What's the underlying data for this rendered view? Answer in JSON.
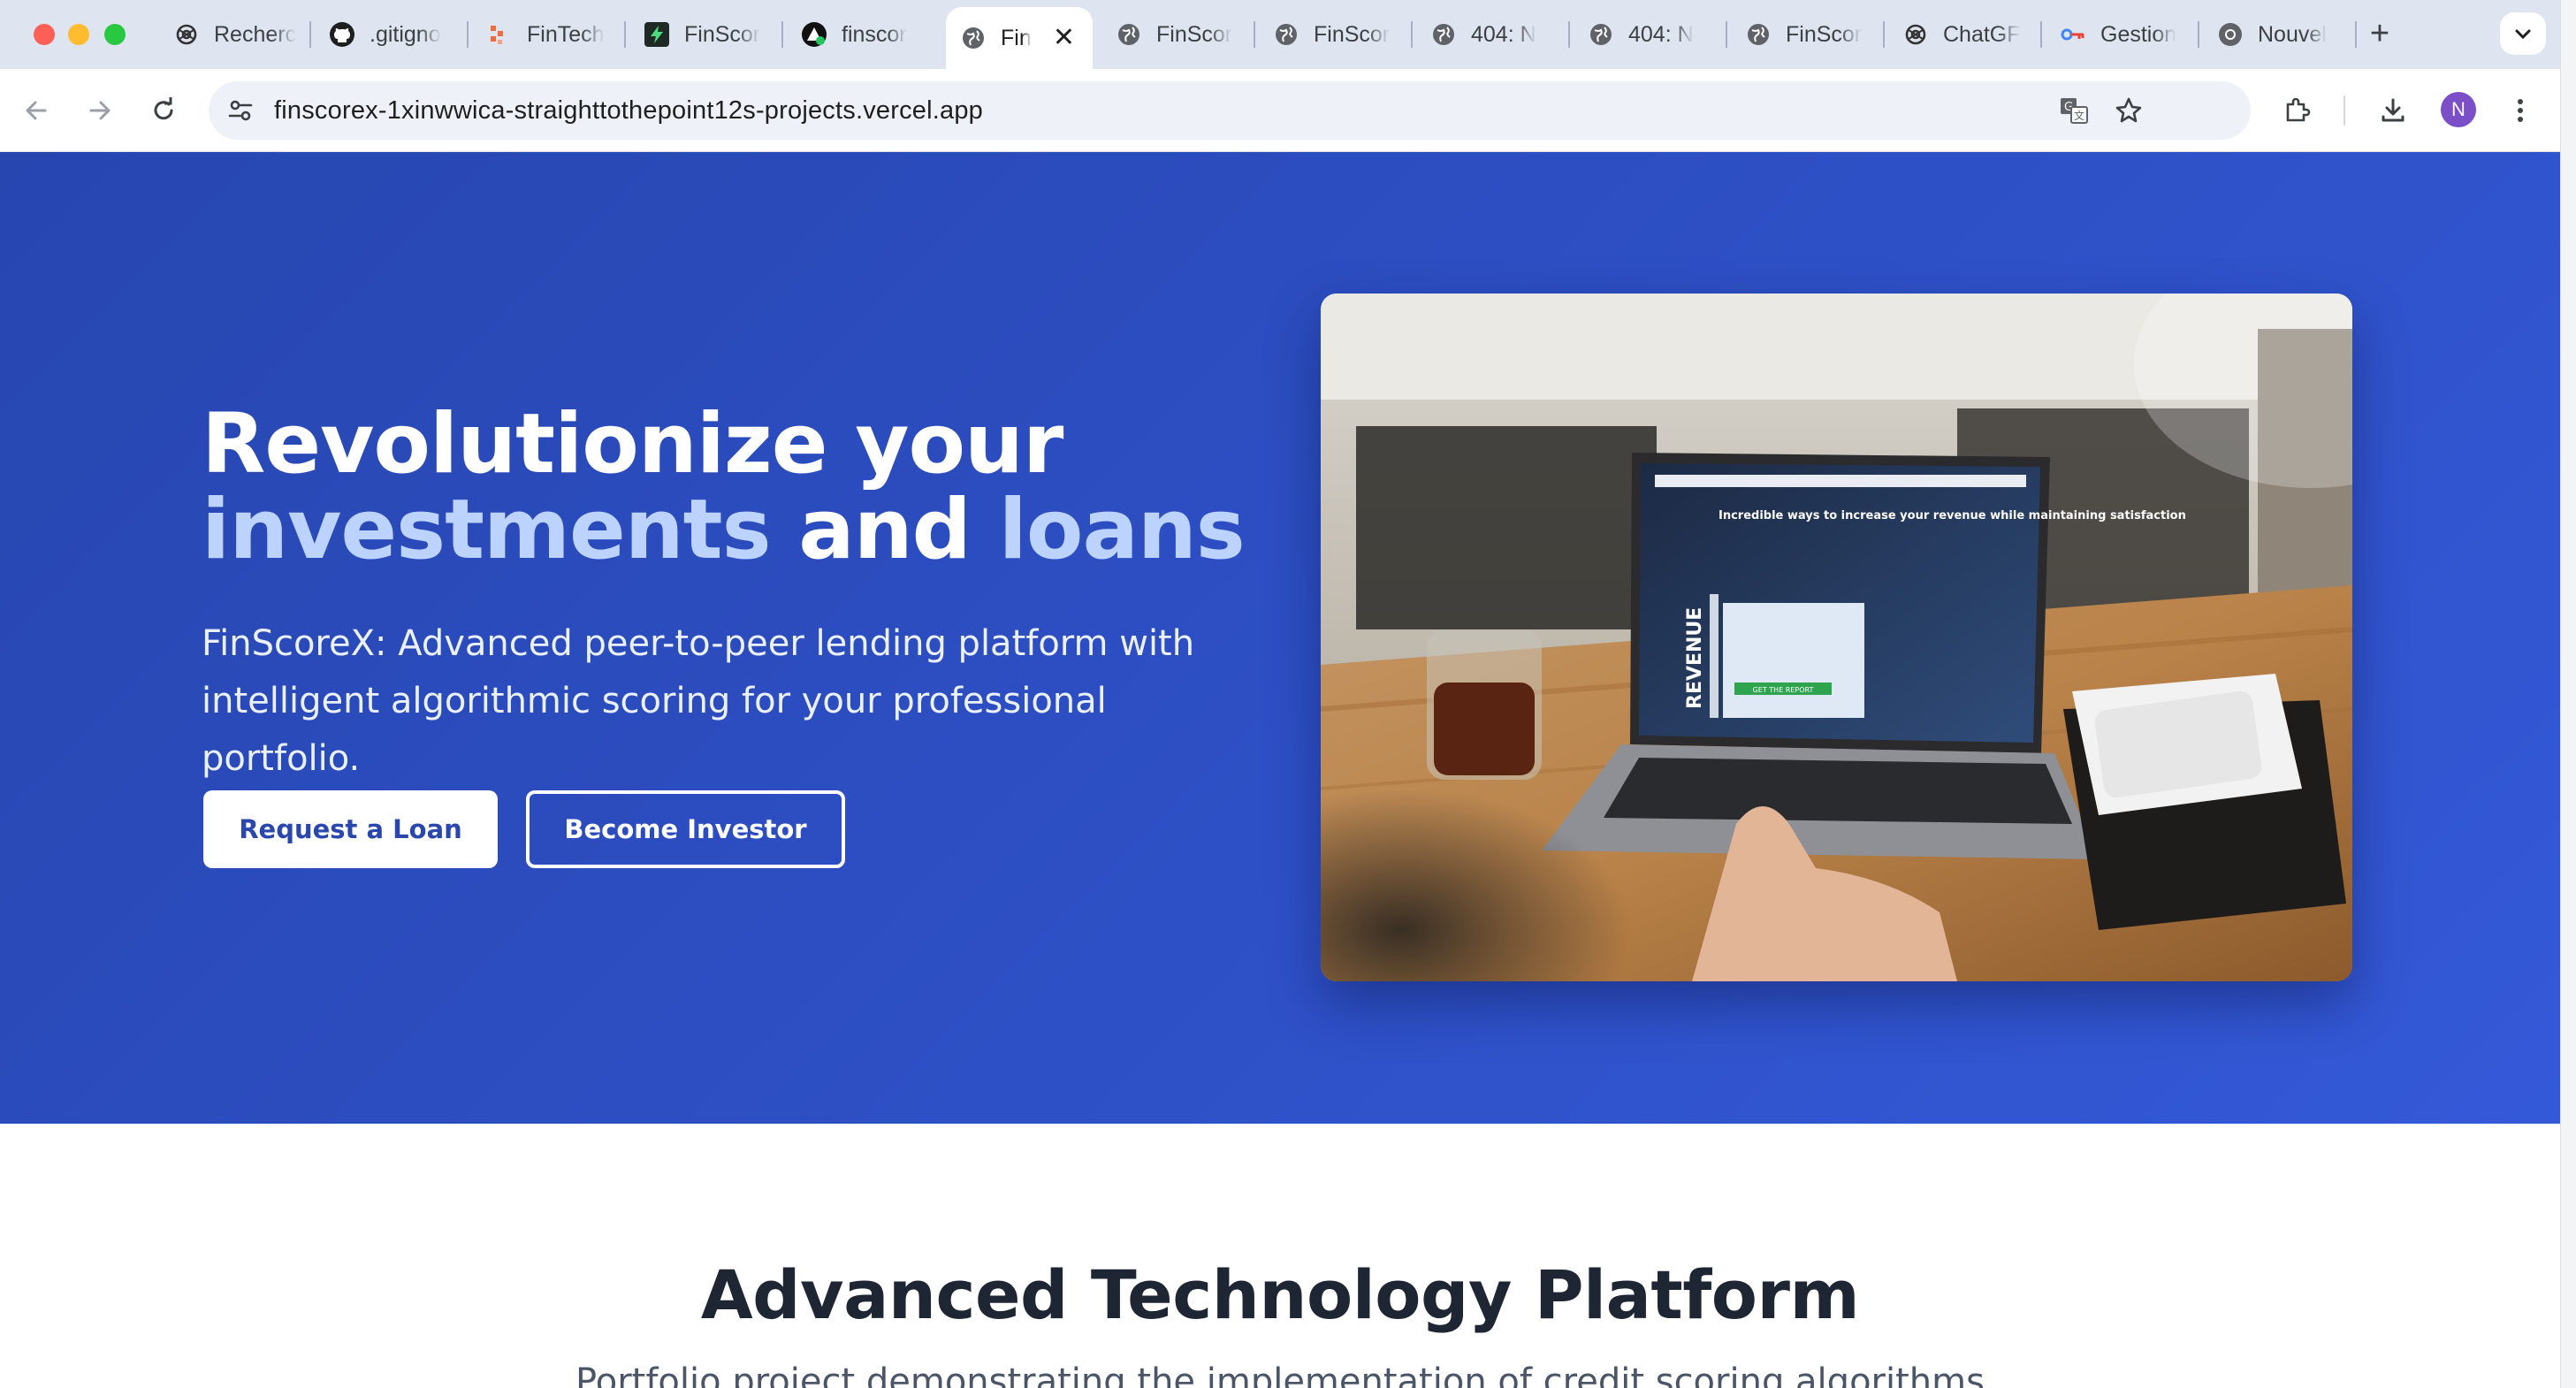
{
  "browser": {
    "tabs": [
      {
        "title": "Recherc",
        "icon": "chatgpt-icon"
      },
      {
        "title": ".gitigno",
        "icon": "github-icon"
      },
      {
        "title": "FinTech",
        "icon": "dots-logo-icon"
      },
      {
        "title": "FinScor",
        "icon": "bolt-icon"
      },
      {
        "title": "finscor",
        "icon": "triangle-logo-icon"
      },
      {
        "title": "Fin",
        "icon": "globe-icon",
        "active": true
      },
      {
        "title": "FinScor",
        "icon": "globe-icon"
      },
      {
        "title": "FinScor",
        "icon": "globe-icon"
      },
      {
        "title": "404: N",
        "icon": "globe-icon"
      },
      {
        "title": "404: N",
        "icon": "globe-icon"
      },
      {
        "title": "FinScor",
        "icon": "globe-icon"
      },
      {
        "title": "ChatGF",
        "icon": "chatgpt-icon"
      },
      {
        "title": "Gestion",
        "icon": "key-icon"
      },
      {
        "title": "Nouvel",
        "icon": "chrome-icon"
      }
    ],
    "url": "finscorex-1xinwwica-straighttothepoint12s-projects.vercel.app",
    "profile_initial": "N",
    "colors": {
      "tabstrip": "#dfe4f1",
      "omnibox": "#eef1f8",
      "avatar": "#7b4fc8"
    }
  },
  "hero": {
    "title_part1": "Revolutionize your",
    "title_highlight1": "investments",
    "title_mid": " and ",
    "title_highlight2": "loans",
    "subtitle": "FinScoreX: Advanced peer-to-peer lending platform with intelligent algorithmic scoring for your professional portfolio.",
    "primary_button": "Request a Loan",
    "secondary_button": "Become Investor",
    "image": {
      "headline": "Incredible ways to increase your revenue while maintaining satisfaction",
      "side_text": "REVENUE",
      "cta": "GET THE REPORT"
    },
    "colors": {
      "background": "#2e50c6",
      "highlight": "#bcd3ff",
      "button_text": "#2a47ad"
    }
  },
  "section": {
    "title": "Advanced Technology Platform",
    "subtitle": "Portfolio project demonstrating the implementation of credit scoring algorithms"
  }
}
